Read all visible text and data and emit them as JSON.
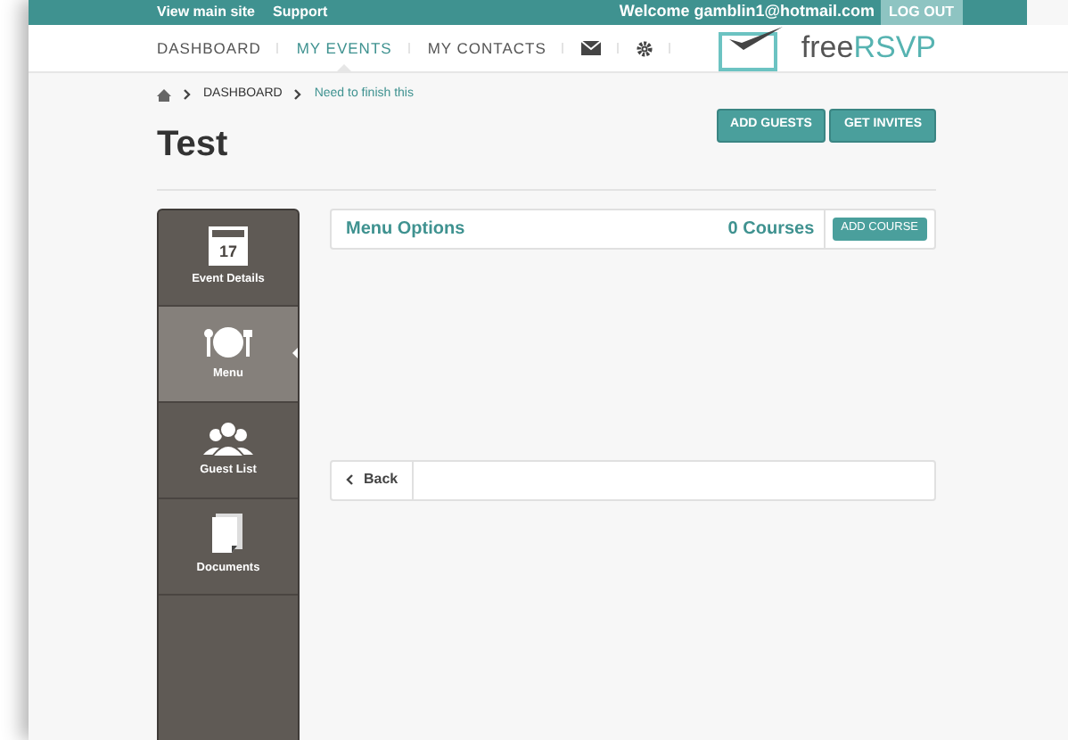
{
  "top_bar": {
    "links": [
      "View main site",
      "Support"
    ],
    "welcome": "Welcome gamblin1@hotmail.com",
    "logout": "LOG OUT"
  },
  "nav": {
    "items": [
      {
        "kind": "text",
        "label": "DASHBOARD",
        "selected": false
      },
      {
        "kind": "text",
        "label": "MY EVENTS",
        "selected": true
      },
      {
        "kind": "text",
        "label": "MY CONTACTS",
        "selected": false
      },
      {
        "kind": "mail",
        "selected": false
      },
      {
        "kind": "settings",
        "selected": false
      }
    ],
    "logo": {
      "prefix": "free",
      "suffix": "RSVP"
    }
  },
  "breadcrumb": [
    "DASHBOARD",
    "Need to finish this"
  ],
  "title": "Test",
  "header_buttons": [
    "ADD GUESTS",
    "GET INVITES"
  ],
  "sidebar": {
    "items": [
      {
        "kind": "calendar",
        "icon_text": "17",
        "label": "Event Details",
        "selected": false
      },
      {
        "kind": "menu",
        "label": "Menu",
        "selected": true
      },
      {
        "kind": "guests",
        "label": "Guest List",
        "selected": false
      },
      {
        "kind": "documents",
        "label": "Documents",
        "selected": false
      }
    ]
  },
  "menu_panel": {
    "title": "Menu Options",
    "count": "0 Courses",
    "button": "ADD COURSE"
  },
  "back_button": "Back"
}
